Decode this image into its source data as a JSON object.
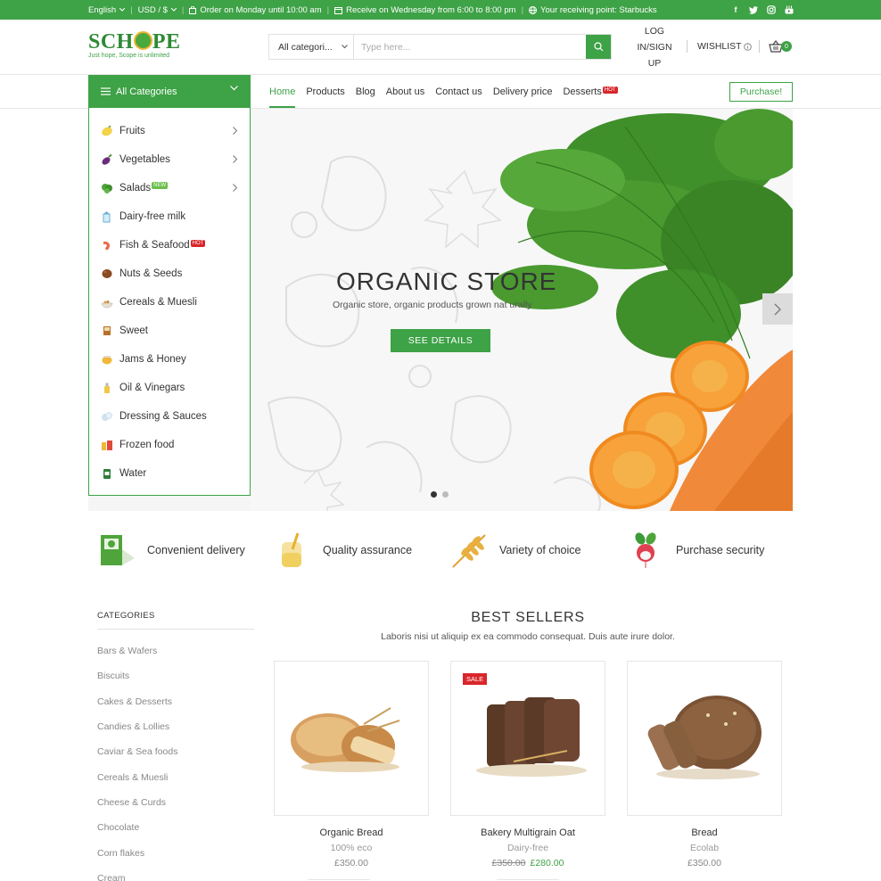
{
  "colors": {
    "brand": "#3ea247",
    "hot": "#d9262b",
    "text": "#333333"
  },
  "topbar": {
    "language": "English",
    "currency": "USD / $",
    "order_note": "Order on Monday until 10:00 am",
    "receive_note": "Receive on Wednesday from 6:00 to 8:00 pm",
    "receiving_point": "Your receiving point: Starbucks",
    "socials": [
      "facebook-icon",
      "twitter-icon",
      "instagram-icon",
      "youtube-icon"
    ]
  },
  "header": {
    "logo_pre": "SCH",
    "logo_post": "PE",
    "logo_tagline": "Just hope, Scope is unlimited",
    "search_category": "All categori...",
    "search_placeholder": "Type here...",
    "login_label": "LOG IN/SIGN UP",
    "wishlist_label": "WISHLIST",
    "cart_count": "0"
  },
  "nav": {
    "all_categories": "All Categories",
    "items": [
      {
        "label": "Home",
        "active": true
      },
      {
        "label": "Products"
      },
      {
        "label": "Blog"
      },
      {
        "label": "About us"
      },
      {
        "label": "Contact us"
      },
      {
        "label": "Delivery price"
      },
      {
        "label": "Desserts",
        "badge": "HOT"
      }
    ],
    "purchase_label": "Purchase!"
  },
  "categories": [
    {
      "label": "Fruits",
      "icon": "lemon-icon",
      "arrow": true
    },
    {
      "label": "Vegetables",
      "icon": "eggplant-icon",
      "arrow": true
    },
    {
      "label": "Salads",
      "icon": "lettuce-icon",
      "arrow": true,
      "badge": "NEW"
    },
    {
      "label": "Dairy-free milk",
      "icon": "milk-icon"
    },
    {
      "label": "Fish & Seafood",
      "icon": "shrimp-icon",
      "badge": "HOT"
    },
    {
      "label": "Nuts & Seeds",
      "icon": "nut-icon"
    },
    {
      "label": "Cereals & Muesli",
      "icon": "cereal-icon"
    },
    {
      "label": "Sweet",
      "icon": "candy-icon"
    },
    {
      "label": "Jams & Honey",
      "icon": "honey-icon"
    },
    {
      "label": "Oil & Vinegars",
      "icon": "oil-bottle-icon"
    },
    {
      "label": "Dressing & Sauces",
      "icon": "sauce-icon"
    },
    {
      "label": "Frozen food",
      "icon": "frozen-food-icon"
    },
    {
      "label": "Water",
      "icon": "water-bottle-icon"
    }
  ],
  "hero": {
    "title": "ORGANIC STORE",
    "subtitle": "Organic store, organic products grown nat urally",
    "button": "SEE DETAILS",
    "slide": 1,
    "slides": 2
  },
  "features": [
    {
      "label": "Convenient delivery",
      "icon": "delivery-box-icon"
    },
    {
      "label": "Quality assurance",
      "icon": "juice-jar-icon"
    },
    {
      "label": "Variety of choice",
      "icon": "wheat-icon"
    },
    {
      "label": "Purchase security",
      "icon": "radish-icon"
    }
  ],
  "sidebar": {
    "title": "CATEGORIES",
    "items": [
      "Bars & Wafers",
      "Biscuits",
      "Cakes & Desserts",
      "Candies & Lollies",
      "Caviar & Sea foods",
      "Cereals & Muesli",
      "Cheese & Curds",
      "Chocolate",
      "Corn flakes",
      "Cream"
    ]
  },
  "best_sellers": {
    "title": "BEST SELLERS",
    "subtitle": "Laboris nisi ut aliquip ex ea commodo consequat. Duis aute irure dolor.",
    "products": [
      {
        "name": "Organic Bread",
        "brand": "100% eco",
        "price": "£350.00"
      },
      {
        "name": "Bakery Multigrain Oat",
        "brand": "Dairy-free",
        "old_price": "£350.00",
        "price": "£280.00",
        "badge": "SALE"
      },
      {
        "name": "Bread",
        "brand": "Ecolab",
        "price": "£350.00"
      }
    ]
  }
}
